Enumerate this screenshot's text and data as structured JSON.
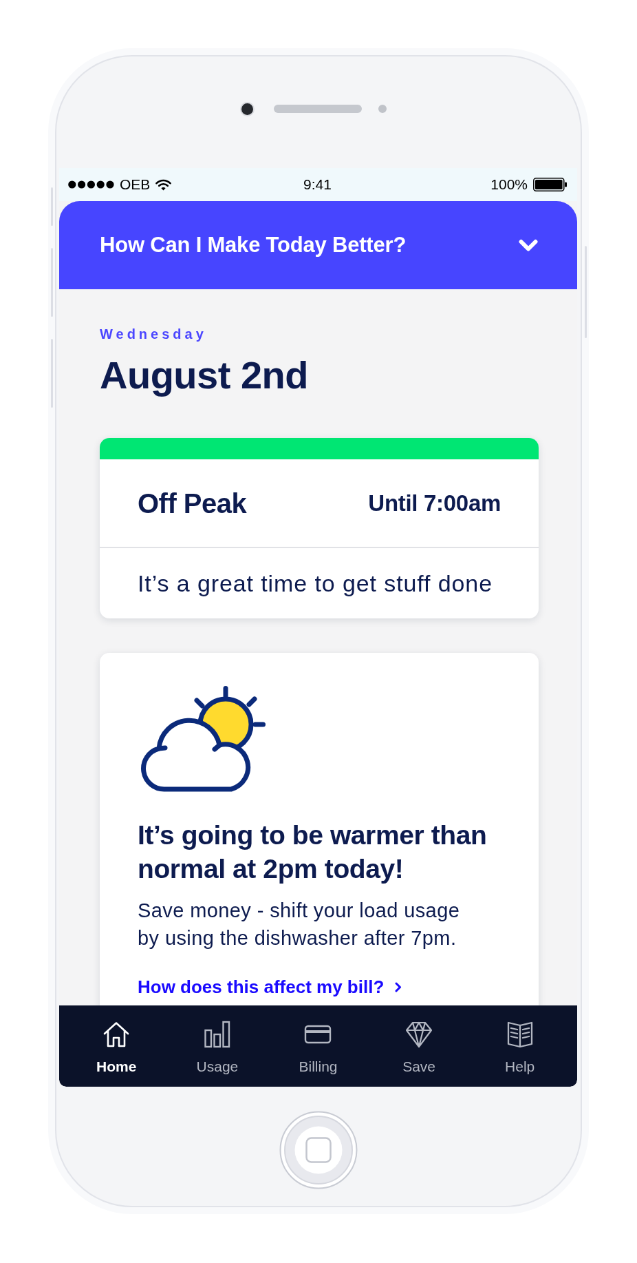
{
  "status_bar": {
    "carrier": "OEB",
    "time": "9:41",
    "battery": "100%"
  },
  "header": {
    "title": "How Can I Make Today Better?"
  },
  "date": {
    "weekday": "Wednesday",
    "date": "August 2nd"
  },
  "rate_card": {
    "period": "Off Peak",
    "until": "Until 7:00am",
    "message": "It’s a great time to get stuff done"
  },
  "tip_card": {
    "title": "It’s going to be warmer than normal at 2pm today!",
    "body": "Save money - shift your load usage by using the dishwasher after 7pm.",
    "link": "How does this affect my bill?"
  },
  "nav": [
    {
      "label": "Home",
      "selected": true
    },
    {
      "label": "Usage",
      "selected": false
    },
    {
      "label": "Billing",
      "selected": false
    },
    {
      "label": "Save",
      "selected": false
    },
    {
      "label": "Help",
      "selected": false
    }
  ]
}
